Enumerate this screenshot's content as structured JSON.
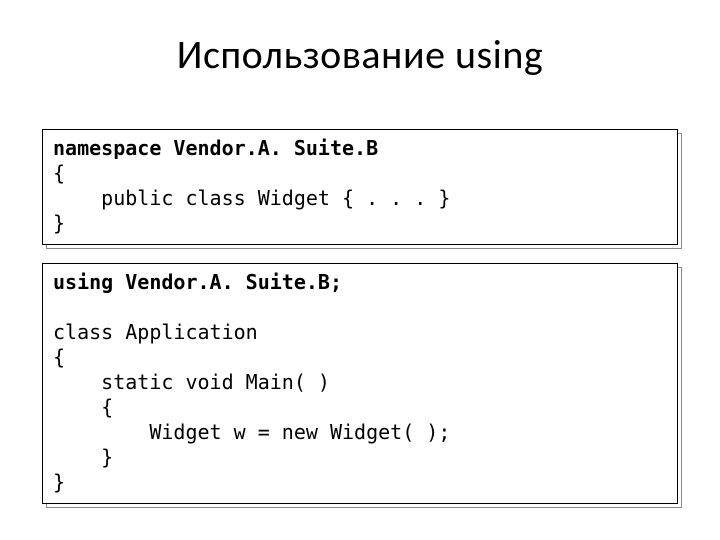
{
  "title": "Использование using",
  "code1": {
    "l1a": "namespace",
    "l1b": " Vendor.A. Suite.B",
    "l2": "{",
    "l3": "    public class Widget { . . . }",
    "l4": "}"
  },
  "code2": {
    "l1a": "using",
    "l1b": " Vendor.A. Suite.B;",
    "blank": "",
    "l2": "class Application",
    "l3": "{",
    "l4": "    static void Main( )",
    "l5": "    {",
    "l6": "        Widget w = new Widget( );",
    "l7": "    }",
    "l8": "}"
  }
}
